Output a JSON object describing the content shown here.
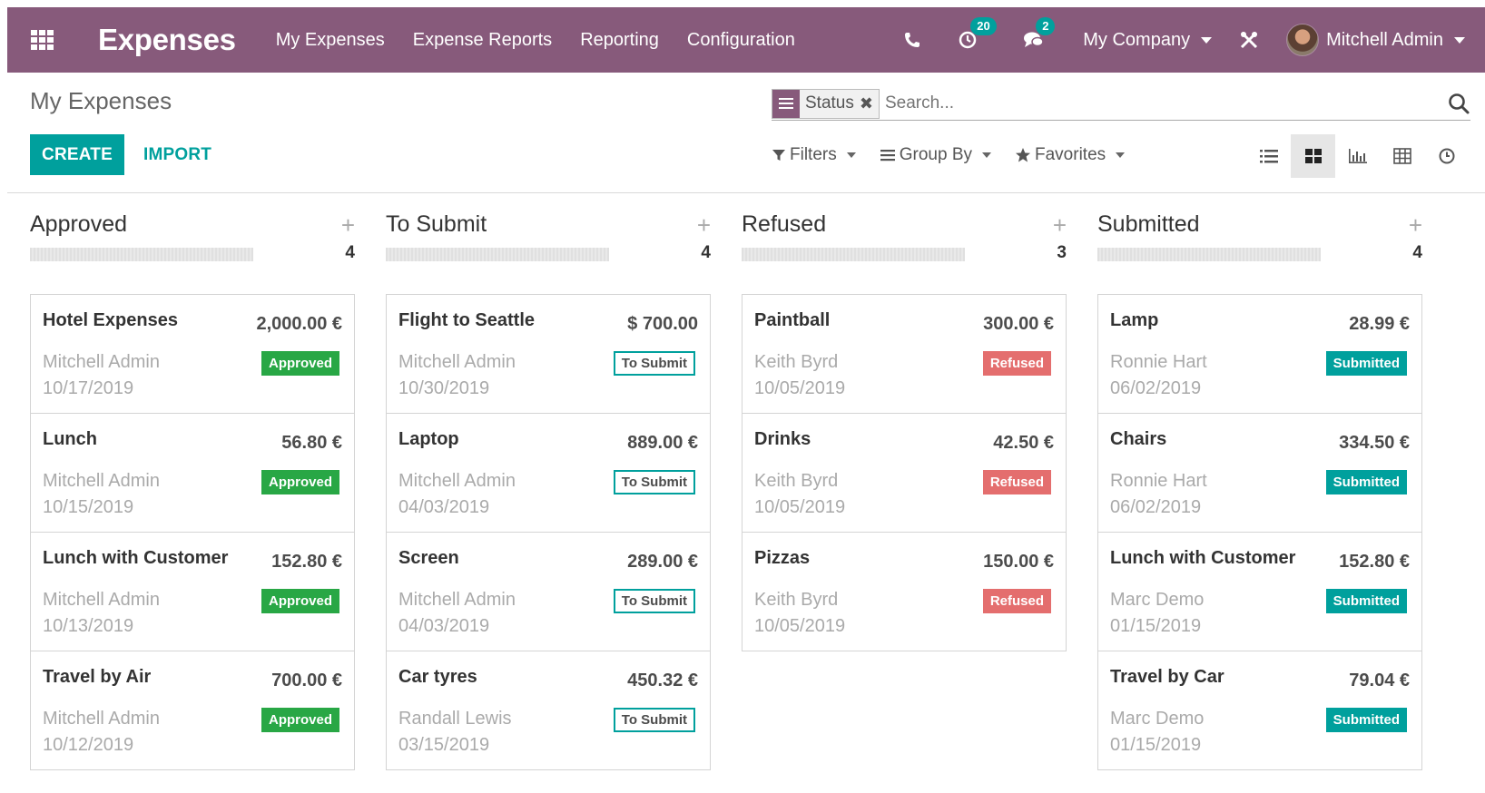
{
  "navbar": {
    "brand": "Expenses",
    "menu": [
      "My Expenses",
      "Expense Reports",
      "Reporting",
      "Configuration"
    ],
    "activity_count": "20",
    "messages_count": "2",
    "company": "My Company",
    "user": "Mitchell Admin",
    "bg_color": "#875a7b"
  },
  "control": {
    "breadcrumb": "My Expenses",
    "create_label": "CREATE",
    "import_label": "IMPORT",
    "facet_value": "Status",
    "search_placeholder": "Search...",
    "filters_label": "Filters",
    "groupby_label": "Group By",
    "favorites_label": "Favorites",
    "views": [
      "list-icon",
      "kanban-icon",
      "graph-icon",
      "pivot-icon",
      "activity-icon"
    ],
    "active_view": "kanban-icon"
  },
  "columns": [
    {
      "title": "Approved",
      "count": "4",
      "cards": [
        {
          "title": "Hotel Expenses",
          "amount": "2,000.00 €",
          "employee": "Mitchell Admin",
          "date": "10/17/2019",
          "state": "Approved"
        },
        {
          "title": "Lunch",
          "amount": "56.80 €",
          "employee": "Mitchell Admin",
          "date": "10/15/2019",
          "state": "Approved"
        },
        {
          "title": "Lunch with Customer",
          "amount": "152.80 €",
          "employee": "Mitchell Admin",
          "date": "10/13/2019",
          "state": "Approved"
        },
        {
          "title": "Travel by Air",
          "amount": "700.00 €",
          "employee": "Mitchell Admin",
          "date": "10/12/2019",
          "state": "Approved"
        }
      ]
    },
    {
      "title": "To Submit",
      "count": "4",
      "cards": [
        {
          "title": "Flight to Seattle",
          "amount": "$ 700.00",
          "employee": "Mitchell Admin",
          "date": "10/30/2019",
          "state": "To Submit"
        },
        {
          "title": "Laptop",
          "amount": "889.00 €",
          "employee": "Mitchell Admin",
          "date": "04/03/2019",
          "state": "To Submit"
        },
        {
          "title": "Screen",
          "amount": "289.00 €",
          "employee": "Mitchell Admin",
          "date": "04/03/2019",
          "state": "To Submit"
        },
        {
          "title": "Car tyres",
          "amount": "450.32 €",
          "employee": "Randall Lewis",
          "date": "03/15/2019",
          "state": "To Submit"
        }
      ]
    },
    {
      "title": "Refused",
      "count": "3",
      "cards": [
        {
          "title": "Paintball",
          "amount": "300.00 €",
          "employee": "Keith Byrd",
          "date": "10/05/2019",
          "state": "Refused"
        },
        {
          "title": "Drinks",
          "amount": "42.50 €",
          "employee": "Keith Byrd",
          "date": "10/05/2019",
          "state": "Refused"
        },
        {
          "title": "Pizzas",
          "amount": "150.00 €",
          "employee": "Keith Byrd",
          "date": "10/05/2019",
          "state": "Refused"
        }
      ]
    },
    {
      "title": "Submitted",
      "count": "4",
      "cards": [
        {
          "title": "Lamp",
          "amount": "28.99 €",
          "employee": "Ronnie Hart",
          "date": "06/02/2019",
          "state": "Submitted"
        },
        {
          "title": "Chairs",
          "amount": "334.50 €",
          "employee": "Ronnie Hart",
          "date": "06/02/2019",
          "state": "Submitted"
        },
        {
          "title": "Lunch with Customer",
          "amount": "152.80 €",
          "employee": "Marc Demo",
          "date": "01/15/2019",
          "state": "Submitted"
        },
        {
          "title": "Travel by Car",
          "amount": "79.04 €",
          "employee": "Marc Demo",
          "date": "01/15/2019",
          "state": "Submitted"
        }
      ]
    }
  ],
  "state_colors": {
    "Approved": "#28a745",
    "To Submit": "#00a09d",
    "Refused": "#e46e6e",
    "Submitted": "#00a09d"
  }
}
